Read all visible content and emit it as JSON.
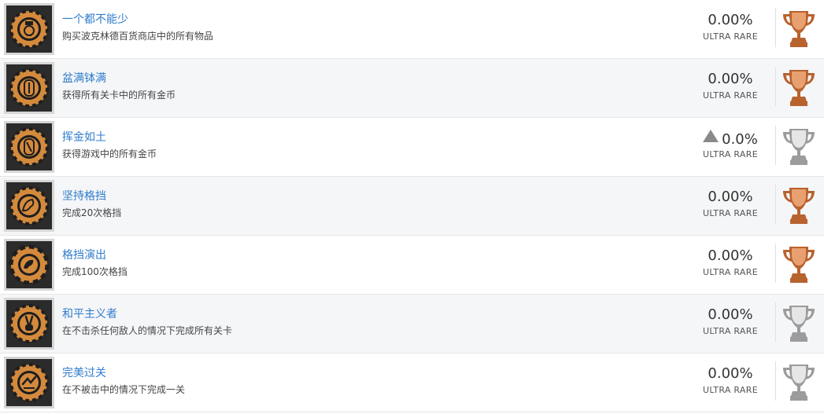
{
  "achievements": [
    {
      "title": "一个都不能少",
      "description": "购买波克林德百货商店中的所有物品",
      "percent": "0.00%",
      "rarity": "ULTRA RARE",
      "trophy": "bronze",
      "icon": "bellhop-badge-icon",
      "marker": false
    },
    {
      "title": "盆满钵满",
      "description": "获得所有关卡中的所有金币",
      "percent": "0.00%",
      "rarity": "ULTRA RARE",
      "trophy": "bronze",
      "icon": "coin-badge-icon",
      "marker": false
    },
    {
      "title": "挥金如土",
      "description": "获得游戏中的所有金币",
      "percent": "0.0%",
      "rarity": "ULTRA RARE",
      "trophy": "silver",
      "icon": "coin-badge-icon",
      "marker": true
    },
    {
      "title": "坚持格挡",
      "description": "完成20次格挡",
      "percent": "0.00%",
      "rarity": "ULTRA RARE",
      "trophy": "bronze",
      "icon": "parry-badge-icon",
      "marker": false
    },
    {
      "title": "格挡演出",
      "description": "完成100次格挡",
      "percent": "0.00%",
      "rarity": "ULTRA RARE",
      "trophy": "bronze",
      "icon": "gear-parry-badge-icon",
      "marker": false
    },
    {
      "title": "和平主义者",
      "description": "在不击杀任何敌人的情况下完成所有关卡",
      "percent": "0.00%",
      "rarity": "ULTRA RARE",
      "trophy": "silver",
      "icon": "peace-sign-badge-icon",
      "marker": false
    },
    {
      "title": "完美过关",
      "description": "在不被击中的情况下完成一关",
      "percent": "0.00%",
      "rarity": "ULTRA RARE",
      "trophy": "silver",
      "icon": "perfect-badge-icon",
      "marker": false
    }
  ],
  "colors": {
    "bronze_light": "#e8a070",
    "bronze_dark": "#b8622e",
    "silver_light": "#e6e6e6",
    "silver_dark": "#9c9c9c",
    "badge_gold": "#d48a3c",
    "title_link": "#2f7ccc"
  }
}
